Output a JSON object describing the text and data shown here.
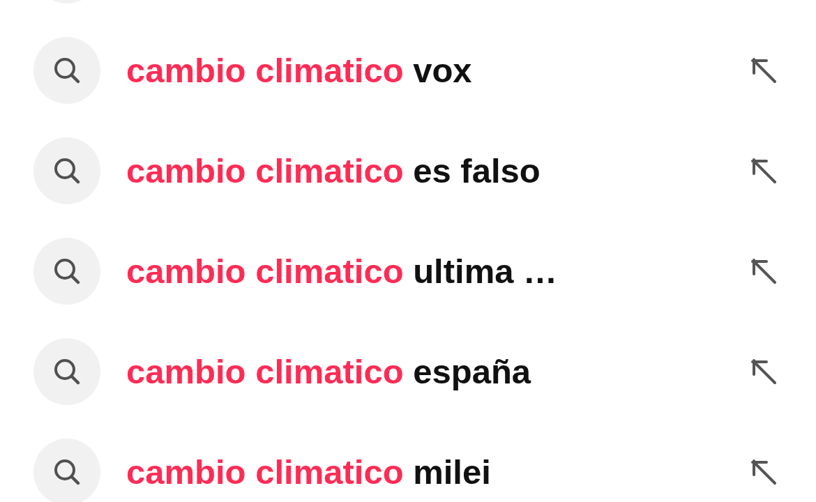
{
  "suggestions": [
    {
      "match": "cambio climatico",
      "rest": "vox"
    },
    {
      "match": "cambio climatico",
      "rest": "es falso"
    },
    {
      "match": "cambio climatico",
      "rest": "ultima …"
    },
    {
      "match": "cambio climatico",
      "rest": "españa"
    },
    {
      "match": "cambio climatico",
      "rest": "milei"
    }
  ]
}
